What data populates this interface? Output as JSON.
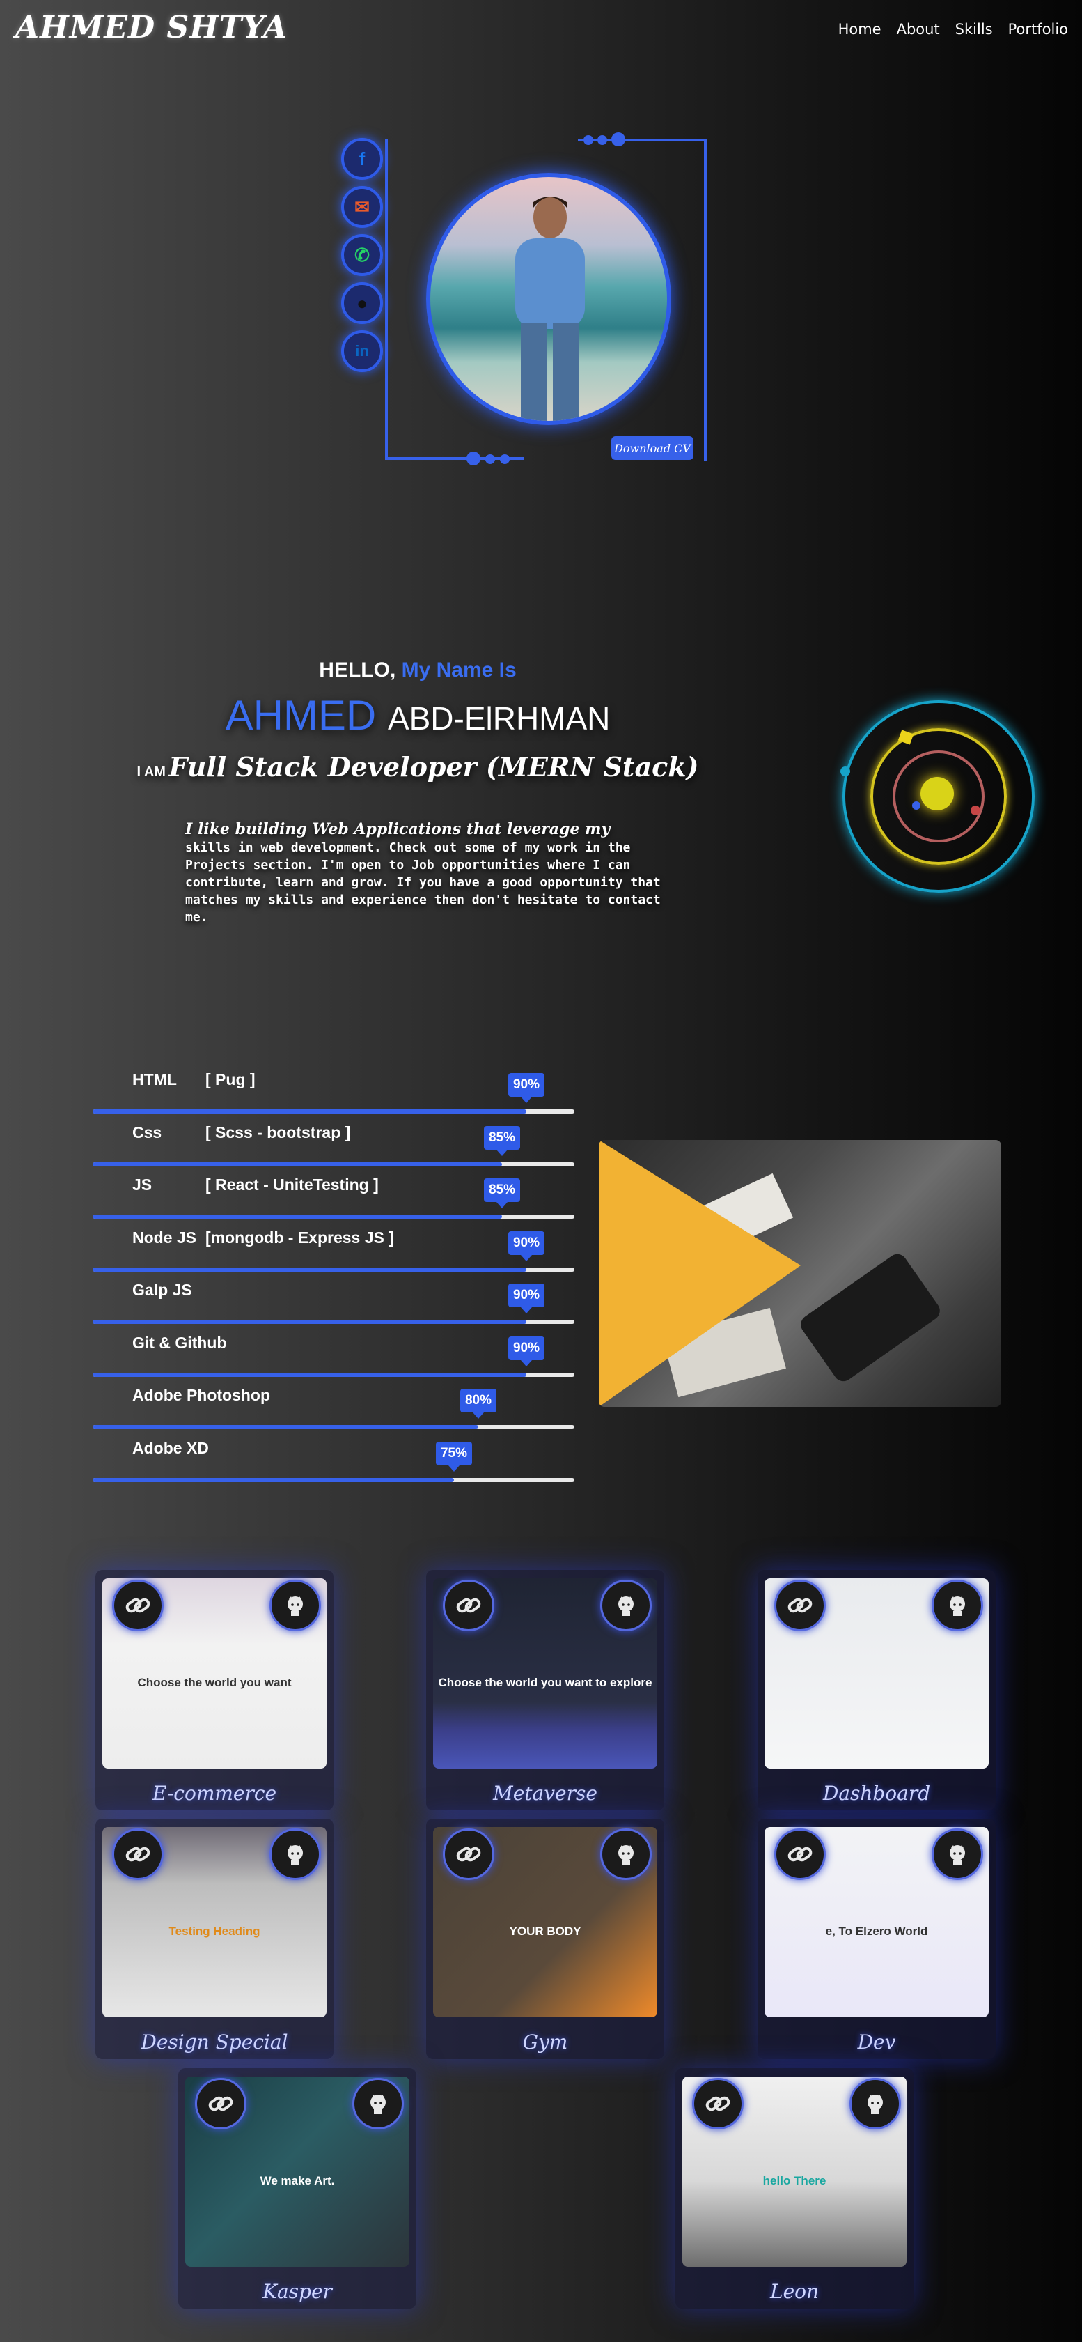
{
  "header": {
    "logo": "AHMED SHTYA",
    "nav": [
      "Home",
      "About",
      "Skills",
      "Portfolio"
    ]
  },
  "hero": {
    "download_cv": "Download CV",
    "social": [
      {
        "name": "facebook-icon",
        "glyph": "f",
        "color": "#1877f2"
      },
      {
        "name": "email-icon",
        "glyph": "✉",
        "color": "#e85a2b"
      },
      {
        "name": "whatsapp-icon",
        "glyph": "☎",
        "color": "#25d366"
      },
      {
        "name": "github-icon",
        "glyph": "●",
        "color": "#111111"
      },
      {
        "name": "linkedin-icon",
        "glyph": "in",
        "color": "#0a66c2"
      }
    ]
  },
  "intro": {
    "hello": "HELLO,",
    "my_name_is": "My Name Is",
    "first_name": "AHMED",
    "last_name": "ABD-ElRHMAN",
    "i_am": "I AM",
    "role": "Full Stack Developer (MERN Stack)",
    "bio_lead": "I like building Web Applications that leverage my",
    "bio_rest": "skills in web development. Check out some of my work in the Projects section. I'm open to Job opportunities where I can contribute, learn and grow. If you have a good opportunity that matches my skills and experience then don't hesitate to contact me."
  },
  "skills": [
    {
      "name": "HTML",
      "tech": "[ Pug ]",
      "percent": "90%",
      "level": 0.9
    },
    {
      "name": "Css",
      "tech": "[ Scss - bootstrap ]",
      "percent": "85%",
      "level": 0.85
    },
    {
      "name": "JS",
      "tech": "[ React - UniteTesting ]",
      "percent": "85%",
      "level": 0.85
    },
    {
      "name": "Node JS",
      "tech": "[mongodb - Express JS ]",
      "percent": "90%",
      "level": 0.9
    },
    {
      "name": "Galp JS",
      "tech": "",
      "percent": "90%",
      "level": 0.9
    },
    {
      "name": "Git & Github",
      "tech": "",
      "percent": "90%",
      "level": 0.9
    },
    {
      "name": "Adobe Photoshop",
      "tech": "",
      "percent": "80%",
      "level": 0.8
    },
    {
      "name": "Adobe XD",
      "tech": "",
      "percent": "75%",
      "level": 0.75
    }
  ],
  "portfolio": [
    {
      "title": "E-commerce",
      "shot_text": "Choose the world you want"
    },
    {
      "title": "Metaverse",
      "shot_text": "Choose the world you want to explore"
    },
    {
      "title": "Dashboard",
      "shot_text": ""
    },
    {
      "title": "Design Special",
      "shot_text": "Testing Heading"
    },
    {
      "title": "Gym",
      "shot_text": "YOUR BODY"
    },
    {
      "title": "Dev",
      "shot_text": "e, To Elzero World"
    },
    {
      "title": "Kasper",
      "shot_text": "We make Art."
    },
    {
      "title": "Leon",
      "shot_text": "hello There"
    }
  ],
  "colors": {
    "accent": "#3761ea",
    "play": "#f2b233",
    "gold": "#ecd31a"
  }
}
